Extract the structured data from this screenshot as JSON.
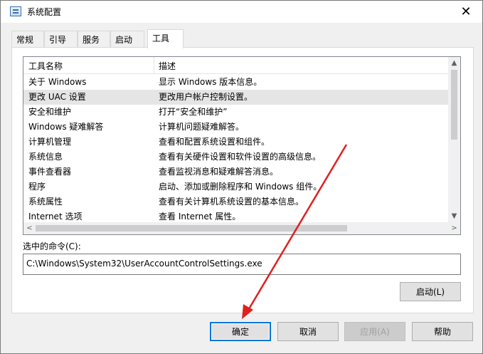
{
  "window": {
    "title": "系统配置",
    "close_glyph": "✕"
  },
  "tabs": [
    {
      "label": "常规"
    },
    {
      "label": "引导"
    },
    {
      "label": "服务"
    },
    {
      "label": "启动"
    },
    {
      "label": "工具"
    }
  ],
  "active_tab": "工具",
  "tools_list": {
    "columns": [
      "工具名称",
      "描述"
    ],
    "rows": [
      {
        "name": "关于 Windows",
        "desc": "显示 Windows 版本信息。"
      },
      {
        "name": "更改 UAC 设置",
        "desc": "更改用户帐户控制设置。"
      },
      {
        "name": "安全和维护",
        "desc": "打开“安全和维护”"
      },
      {
        "name": "Windows 疑难解答",
        "desc": "计算机问题疑难解答。"
      },
      {
        "name": "计算机管理",
        "desc": "查看和配置系统设置和组件。"
      },
      {
        "name": "系统信息",
        "desc": "查看有关硬件设置和软件设置的高级信息。"
      },
      {
        "name": "事件查看器",
        "desc": "查看监视消息和疑难解答消息。"
      },
      {
        "name": "程序",
        "desc": "启动、添加或删除程序和 Windows 组件。"
      },
      {
        "name": "系统属性",
        "desc": "查看有关计算机系统设置的基本信息。"
      },
      {
        "name": "Internet 选项",
        "desc": "查看 Internet 属性。"
      }
    ],
    "selected_row": "更改 UAC 设置",
    "scroll_arrows": {
      "up": "▲",
      "down": "▼",
      "left": "<",
      "right": ">"
    }
  },
  "command": {
    "label": "选中的命令(C):",
    "value": "C:\\Windows\\System32\\UserAccountControlSettings.exe"
  },
  "buttons": {
    "launch": "启动(L)",
    "ok": "确定",
    "cancel": "取消",
    "apply": "应用(A)",
    "help": "帮助"
  },
  "annotation": {
    "arrow_color": "#e02020"
  }
}
